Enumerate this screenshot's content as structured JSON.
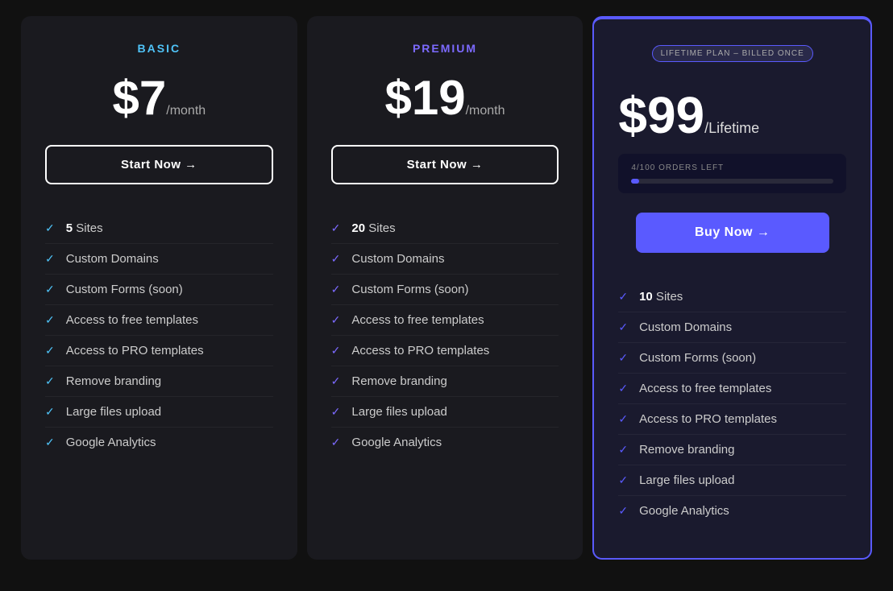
{
  "plans": [
    {
      "id": "basic",
      "title": "BASIC",
      "titleClass": "basic",
      "price": "$7",
      "period": "/month",
      "btnLabel": "Start Now →",
      "features": [
        {
          "bold": "5",
          "text": " Sites"
        },
        {
          "bold": "",
          "text": "Custom Domains"
        },
        {
          "bold": "",
          "text": "Custom Forms (soon)"
        },
        {
          "bold": "",
          "text": "Access to free templates"
        },
        {
          "bold": "",
          "text": "Access to PRO templates"
        },
        {
          "bold": "",
          "text": "Remove branding"
        },
        {
          "bold": "",
          "text": "Large files upload"
        },
        {
          "bold": "",
          "text": "Google Analytics"
        }
      ]
    },
    {
      "id": "premium",
      "title": "PREMIUM",
      "titleClass": "premium",
      "price": "$19",
      "period": "/month",
      "btnLabel": "Start Now →",
      "features": [
        {
          "bold": "20",
          "text": " Sites"
        },
        {
          "bold": "",
          "text": "Custom Domains"
        },
        {
          "bold": "",
          "text": "Custom Forms (soon)"
        },
        {
          "bold": "",
          "text": "Access to free templates"
        },
        {
          "bold": "",
          "text": "Access to PRO templates"
        },
        {
          "bold": "",
          "text": "Remove branding"
        },
        {
          "bold": "",
          "text": "Large files upload"
        },
        {
          "bold": "",
          "text": "Google Analytics"
        }
      ]
    },
    {
      "id": "lifetime",
      "title": null,
      "badge": "LIFETIME PLAN – BILLED ONCE",
      "price": "$99",
      "period": "/Lifetime",
      "ordersLabel": "4/100 ORDERS LEFT",
      "ordersPercent": 4,
      "btnLabel": "Buy Now →",
      "features": [
        {
          "bold": "10",
          "text": " Sites"
        },
        {
          "bold": "",
          "text": "Custom Domains"
        },
        {
          "bold": "",
          "text": "Custom Forms (soon)"
        },
        {
          "bold": "",
          "text": "Access to free templates"
        },
        {
          "bold": "",
          "text": "Access to PRO templates"
        },
        {
          "bold": "",
          "text": "Remove branding"
        },
        {
          "bold": "",
          "text": "Large files upload"
        },
        {
          "bold": "",
          "text": "Google Analytics"
        }
      ]
    }
  ],
  "labels": {
    "start_now": "Start Now →",
    "buy_now": "Buy Now →"
  }
}
